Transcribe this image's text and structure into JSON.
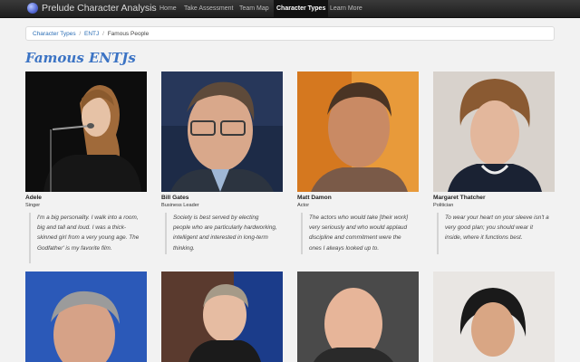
{
  "brand": "Prelude Character Analysis",
  "nav": [
    {
      "label": "Home",
      "active": false
    },
    {
      "label": "Take Assessment",
      "active": false
    },
    {
      "label": "Team Map",
      "active": false
    },
    {
      "label": "Character Types",
      "active": true
    },
    {
      "label": "Learn More",
      "active": false
    }
  ],
  "breadcrumb": {
    "link1": "Character Types",
    "sep": "/",
    "link2": "ENTJ",
    "current": "Famous People"
  },
  "page_title": "Famous ENTJs",
  "people": [
    {
      "name": "Adele",
      "role": "Singer",
      "quote": "I'm a big personality. I walk into a room, big and tall and loud. I was a thick-skinned girl from a very young age. The Godfather' is my favorite film."
    },
    {
      "name": "Bill Gates",
      "role": "Business Leader",
      "quote": "Society is best served by electing people who are particularly hardworking, intelligent and interested in long-term thinking."
    },
    {
      "name": "Matt Damon",
      "role": "Actor",
      "quote": "The actors who would take [their work] very seriously and who would applaud discipline and commitment were the ones I always looked up to."
    },
    {
      "name": "Margaret Thatcher",
      "role": "Politician",
      "quote": "To wear your heart on your sleeve isn't a very good plan; you should wear it inside, where it functions best."
    }
  ],
  "colors": {
    "navbar": "#262626",
    "accent": "#3b73c4",
    "link": "#2a6db5",
    "background": "#f2f2f2"
  }
}
